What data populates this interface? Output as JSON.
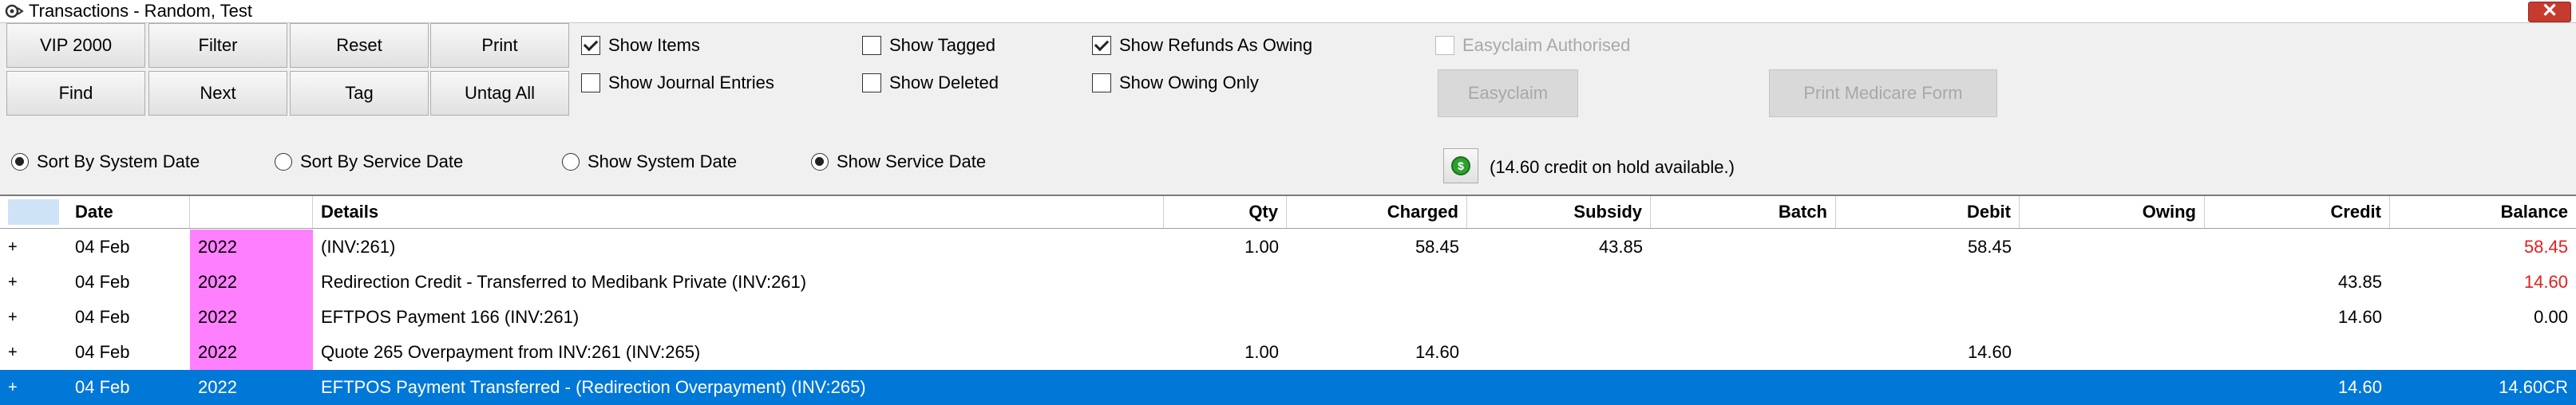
{
  "window": {
    "title": "Transactions - Random, Test",
    "icon": "gear-icon",
    "close_icon": "close-icon"
  },
  "buttons": {
    "vip": "VIP 2000",
    "filter": "Filter",
    "reset": "Reset",
    "print": "Print",
    "find": "Find",
    "next": "Next",
    "tag": "Tag",
    "untag_all": "Untag All",
    "easyclaim": "Easyclaim",
    "print_medicare": "Print Medicare Form"
  },
  "checkboxes": {
    "show_items": {
      "label": "Show Items",
      "checked": true
    },
    "show_journal": {
      "label": "Show Journal Entries",
      "checked": false
    },
    "show_tagged": {
      "label": "Show Tagged",
      "checked": false
    },
    "show_deleted": {
      "label": "Show Deleted",
      "checked": false
    },
    "show_refunds": {
      "label": "Show Refunds As Owing",
      "checked": true
    },
    "show_owing": {
      "label": "Show Owing Only",
      "checked": false
    },
    "easyclaim_auth": {
      "label": "Easyclaim Authorised",
      "checked": false
    }
  },
  "radios": {
    "sort_system": {
      "label": "Sort By System Date",
      "selected": true
    },
    "sort_service": {
      "label": "Sort By Service Date",
      "selected": false
    },
    "show_system": {
      "label": "Show System Date",
      "selected": false
    },
    "show_service": {
      "label": "Show Service Date",
      "selected": true
    }
  },
  "credit_notice": "(14.60 credit on hold available.)",
  "credit_icon": "dollar-coin-icon",
  "colors": {
    "selection": "#0078d7",
    "year_highlight": "#ff80ff",
    "negative_balance": "#e02020",
    "close_button": "#c73a2e"
  },
  "grid": {
    "columns": [
      "",
      "Date",
      "",
      "Details",
      "Qty",
      "Charged",
      "Subsidy",
      "Batch",
      "Debit",
      "Owing",
      "Credit",
      "Balance"
    ],
    "rows": [
      {
        "expand": "+",
        "date": "04 Feb",
        "year": "2022",
        "details": "(INV:261)",
        "qty": "1.00",
        "charged": "58.45",
        "subsidy": "43.85",
        "batch": "",
        "debit": "58.45",
        "owing": "",
        "credit": "",
        "balance": "58.45",
        "balance_red": true,
        "selected": false
      },
      {
        "expand": "+",
        "date": "04 Feb",
        "year": "2022",
        "details": "Redirection Credit - Transferred to Medibank Private (INV:261)",
        "qty": "",
        "charged": "",
        "subsidy": "",
        "batch": "",
        "debit": "",
        "owing": "",
        "credit": "43.85",
        "balance": "14.60",
        "balance_red": true,
        "selected": false
      },
      {
        "expand": "+",
        "date": "04 Feb",
        "year": "2022",
        "details": "EFTPOS Payment  166  (INV:261)",
        "qty": "",
        "charged": "",
        "subsidy": "",
        "batch": "",
        "debit": "",
        "owing": "",
        "credit": "14.60",
        "balance": "0.00",
        "balance_red": false,
        "selected": false
      },
      {
        "expand": "+",
        "date": "04 Feb",
        "year": "2022",
        "details": "Quote 265 Overpayment from INV:261 (INV:265)",
        "qty": "1.00",
        "charged": "14.60",
        "subsidy": "",
        "batch": "",
        "debit": "14.60",
        "owing": "",
        "credit": "",
        "balance": "",
        "balance_red": false,
        "selected": false
      },
      {
        "expand": "+",
        "date": "04 Feb",
        "year": "2022",
        "details": "EFTPOS Payment Transferred - (Redirection Overpayment) (INV:265)",
        "qty": "",
        "charged": "",
        "subsidy": "",
        "batch": "",
        "debit": "",
        "owing": "",
        "credit": "14.60",
        "balance": "14.60CR",
        "balance_red": false,
        "selected": true
      }
    ]
  }
}
